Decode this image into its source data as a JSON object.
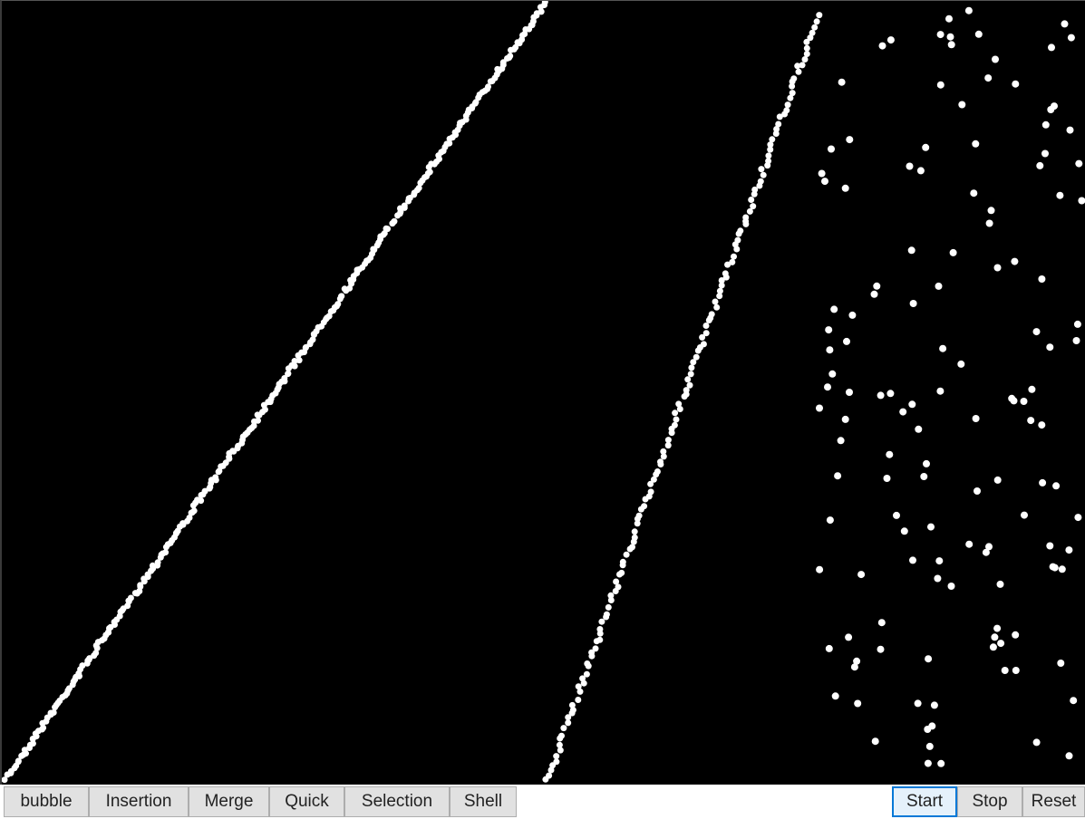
{
  "algorithm_buttons": [
    {
      "label": "bubble"
    },
    {
      "label": "Insertion"
    },
    {
      "label": "Merge"
    },
    {
      "label": "Quick"
    },
    {
      "label": "Selection"
    },
    {
      "label": "Shell"
    }
  ],
  "control_buttons": [
    {
      "label": "Start"
    },
    {
      "label": "Stop"
    },
    {
      "label": "Reset"
    }
  ],
  "focused_button": "Start",
  "colors": {
    "canvas_background": "#000000",
    "dot": "#ffffff",
    "button_face": "#e1e1e1",
    "focus_accent": "#0078d7"
  },
  "visualization": {
    "description_state": "sorting in progress",
    "dot_shape": "circle"
  }
}
